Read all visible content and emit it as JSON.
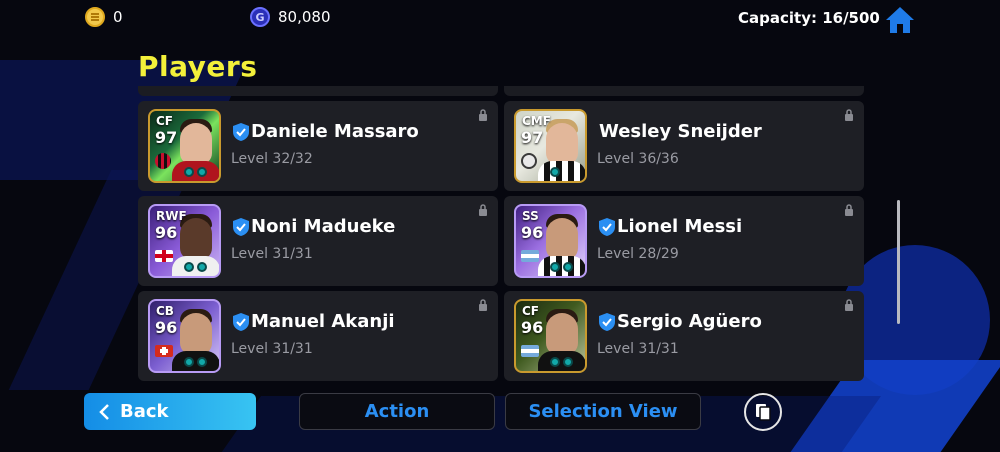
{
  "currency": {
    "ecoins": "0",
    "gp": "80,080",
    "ecoin_icon": "coin-icon",
    "gp_icon": "gp-icon",
    "gp_letter": "G"
  },
  "capacity": "Capacity: 16/500",
  "page_title": "Players",
  "players": [
    {
      "position": "CF",
      "rating": "97",
      "name": "Daniele Massaro",
      "level": "Level 32/32",
      "verified": true
    },
    {
      "position": "CMF",
      "rating": "97",
      "name": "Wesley Sneijder",
      "level": "Level 36/36",
      "verified": false
    },
    {
      "position": "RWF",
      "rating": "96",
      "name": "Noni Madueke",
      "level": "Level 31/31",
      "verified": true
    },
    {
      "position": "SS",
      "rating": "96",
      "name": "Lionel Messi",
      "level": "Level 28/29",
      "verified": true
    },
    {
      "position": "CB",
      "rating": "96",
      "name": "Manuel Akanji",
      "level": "Level 31/31",
      "verified": true
    },
    {
      "position": "CF",
      "rating": "96",
      "name": "Sergio Agüero",
      "level": "Level 31/31",
      "verified": true
    }
  ],
  "buttons": {
    "back": "Back",
    "action": "Action",
    "selection_view": "Selection View"
  },
  "colors": {
    "title": "#f3f03a",
    "accent_blue": "#2b8ff3",
    "card_bg": "#1e1f25"
  }
}
